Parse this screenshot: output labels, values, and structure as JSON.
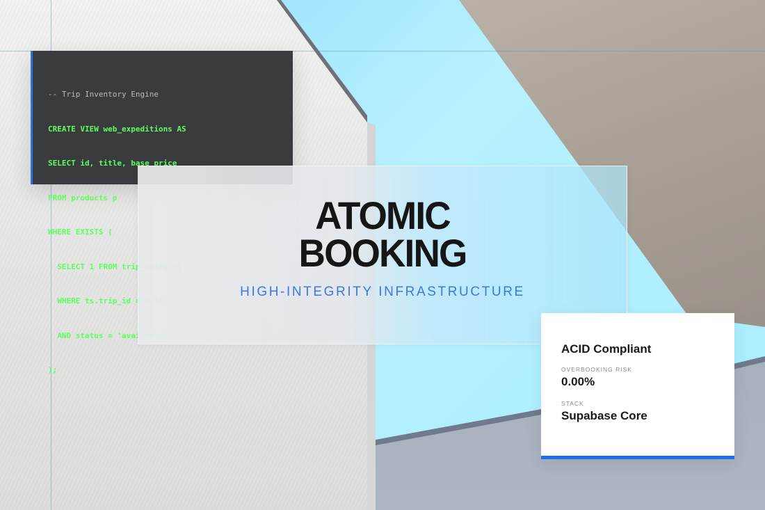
{
  "code_panel": {
    "lines": [
      "-- Trip Inventory Engine",
      "CREATE VIEW web_expeditions AS",
      "SELECT id, title, base_price",
      "FROM products p",
      "WHERE EXISTS (",
      "  SELECT 1 FROM trip_seats ts",
      "  WHERE ts.trip_id = p.id",
      "  AND status = 'available'",
      ");"
    ],
    "code_color": "#5cff5c",
    "comment_color": "#b9bbbe"
  },
  "hero": {
    "title_line1": "ATOMIC",
    "title_line2": "BOOKING",
    "subtitle": "HIGH-INTEGRITY INFRASTRUCTURE"
  },
  "stats": {
    "headline": "ACID Compliant",
    "items": [
      {
        "label": "OVERBOOKING RISK",
        "value": "0.00%"
      },
      {
        "label": "STACK",
        "value": "Supabase Core"
      }
    ],
    "accent_color": "#1f6ef0"
  }
}
